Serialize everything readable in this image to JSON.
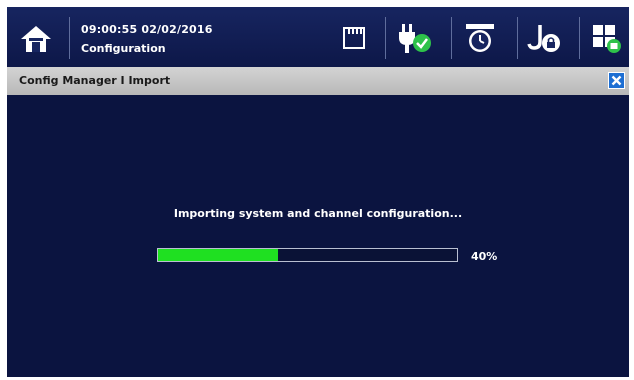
{
  "status_bar": {
    "datetime": "09:00:55 02/02/2016",
    "mode": "Configuration",
    "icons": [
      "home-icon",
      "memory-card-icon",
      "power-ok-icon",
      "alarm-clock-icon",
      "user-lock-icon",
      "screen-layout-icon"
    ]
  },
  "window": {
    "title": "Config Manager I Import",
    "close_icon": "close-icon"
  },
  "import": {
    "message": "Importing system and channel configuration...",
    "progress": 0.4,
    "progress_label": "40%"
  },
  "colors": {
    "background": "#0b1440",
    "titlebar": "#c4c4c4",
    "progress_fill": "#1fe021",
    "close_button": "#1e6fd3"
  }
}
